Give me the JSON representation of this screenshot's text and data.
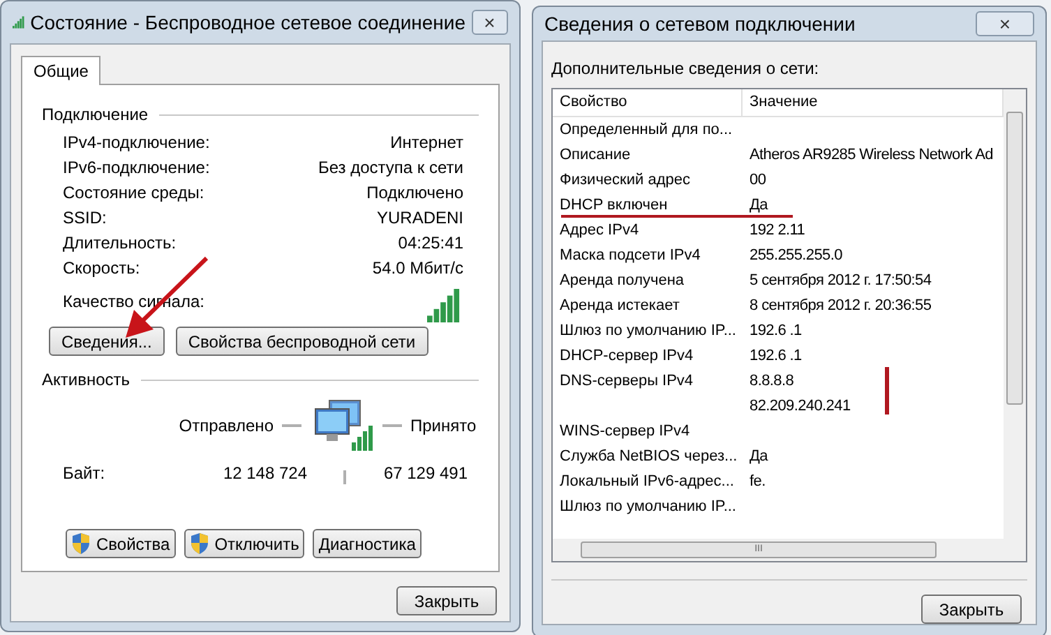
{
  "status_window": {
    "title": "Состояние - Беспроводное сетевое соединение",
    "close_glyph": "×",
    "tabs": [
      {
        "label": "Общие",
        "selected": true
      }
    ],
    "connection": {
      "heading": "Подключение",
      "rows": [
        {
          "label": "IPv4-подключение:",
          "value": "Интернет"
        },
        {
          "label": "IPv6-подключение:",
          "value": "Без доступа к сети"
        },
        {
          "label": "Состояние среды:",
          "value": "Подключено"
        },
        {
          "label": "SSID:",
          "value": "YURADENI"
        },
        {
          "label": "Длительность:",
          "value": "04:25:41"
        },
        {
          "label": "Скорость:",
          "value": "54.0 Мбит/с"
        }
      ],
      "signal_label": "Качество сигнала:"
    },
    "buttons": [
      "Сведения...",
      "Свойства беспроводной сети"
    ],
    "activity": {
      "heading": "Активность",
      "sent_label": "Отправлено",
      "received_label": "Принято",
      "bytes_label": "Байт:",
      "bytes_sent": "12 148 724",
      "bytes_received": "67 129 491"
    },
    "action_buttons": [
      {
        "label": "Свойства",
        "shield": true
      },
      {
        "label": "Отключить",
        "shield": true
      },
      {
        "label": "Диагностика",
        "shield": false
      }
    ],
    "close_button": "Закрыть"
  },
  "details_window": {
    "title": "Сведения о сетевом подключении",
    "close_glyph": "×",
    "caption": "Дополнительные сведения о сети:",
    "columns": [
      "Свойство",
      "Значение"
    ],
    "rows": [
      {
        "property": "Определенный для по..."
      },
      {
        "property": "Описание",
        "value": "Atheros AR9285 Wireless Network Ad"
      },
      {
        "property": "Физический адрес",
        "value": "00"
      },
      {
        "property": "DHCP включен",
        "value": "Да"
      },
      {
        "property": "Адрес IPv4",
        "value": "192 2.11"
      },
      {
        "property": "Маска подсети IPv4",
        "value": "255.255.255.0"
      },
      {
        "property": "Аренда получена",
        "value": "5 сентября 2012 г. 17:50:54"
      },
      {
        "property": "Аренда истекает",
        "value": "8 сентября 2012 г. 20:36:55"
      },
      {
        "property": "Шлюз по умолчанию IP...",
        "value": "192.6 .1"
      },
      {
        "property": "DHCP-сервер IPv4",
        "value": "192.6 .1"
      },
      {
        "property": "DNS-серверы IPv4",
        "value": "8.8.8.8"
      },
      {
        "value": "82.209.240.241"
      },
      {
        "property": "WINS-сервер IPv4"
      },
      {
        "property": "Служба NetBIOS через...",
        "value": "Да"
      },
      {
        "property": "Локальный IPv6-адрес...",
        "value": "fe."
      },
      {
        "property": "Шлюз по умолчанию IP..."
      }
    ],
    "scroll_glyph": "III",
    "close_button": "Закрыть"
  }
}
